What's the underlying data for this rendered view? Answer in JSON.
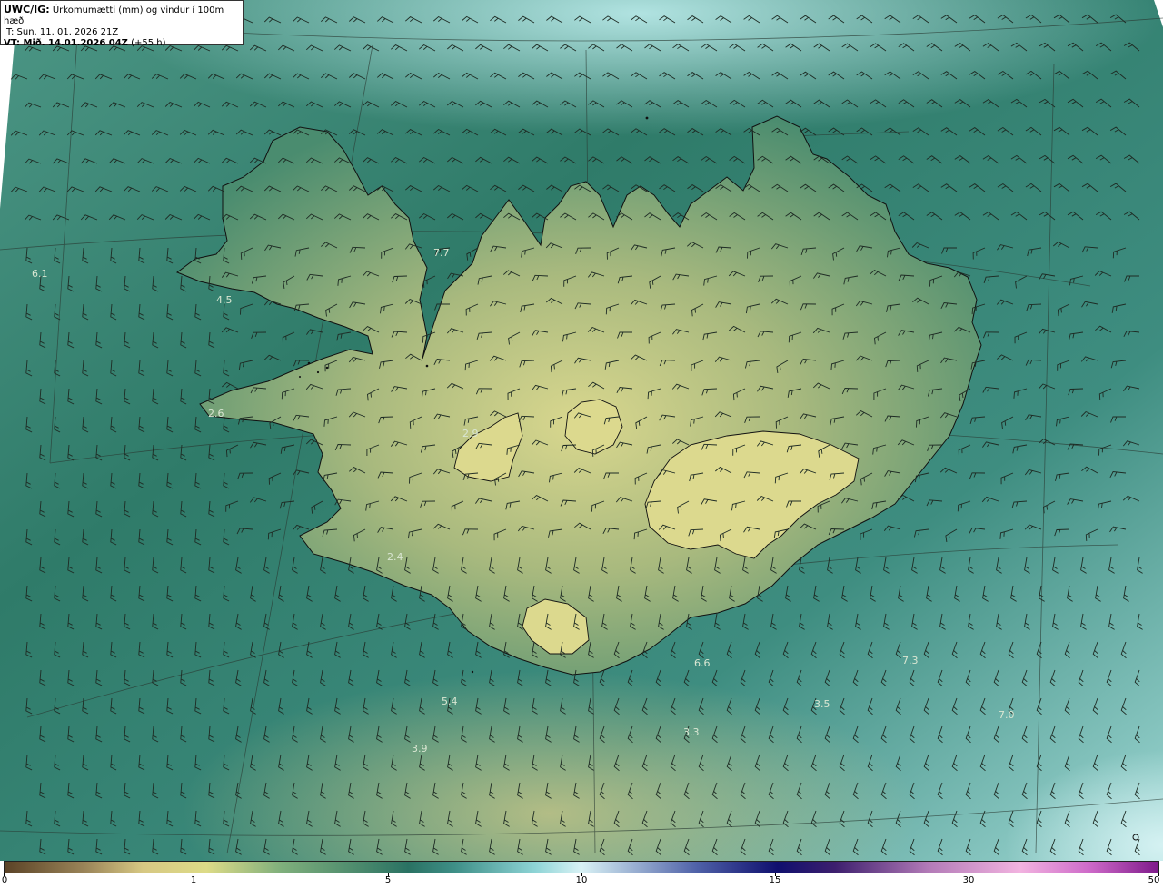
{
  "header": {
    "line1_bold": "UWC/IG:",
    "line1_text": " Úrkomumætti (mm) og vindur í 100m hæð",
    "line2": "IT: Sun. 11. 01. 2026 21Z",
    "line3_bold": "VT: Mið. 14.01.2026 04Z",
    "line3_text": " (+55 h)"
  },
  "map_labels": [
    "6.1",
    "4.5",
    "7.7",
    "2.6",
    "2.9",
    "2.4",
    "6.6",
    "7.3",
    "5.4",
    "3.5",
    "7.0",
    "3.3",
    "3.9"
  ],
  "colorbar": {
    "ticks": [
      "0",
      "1",
      "5",
      "10",
      "15",
      "30",
      "50"
    ]
  },
  "colors": {
    "land_low": "#8fb48a",
    "land_high": "#d9d78e",
    "sea_teal": "#3f8c7b",
    "sea_light": "#a8dfd9",
    "coastline": "#111111"
  }
}
